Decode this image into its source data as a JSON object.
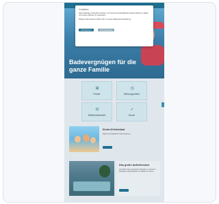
{
  "consent": {
    "title": "Cookies",
    "body1": "Diese Website verwendet Cookies, um Ihnen ein bestmögliches Nutzererlebnis zu bieten und unsere Dienste zu verbessern.",
    "body2": "Weitere Informationen finden Sie in unserer Datenschutzerklärung.",
    "accept_label": "Akzeptieren",
    "settings_label": "Einstellungen"
  },
  "hero": {
    "headline": "Badevergnügen für die ganze Familie"
  },
  "tiles": [
    {
      "label": "Preise",
      "icon": "ticket-icon",
      "glyph": "⊞"
    },
    {
      "label": "Öffnungszeiten",
      "icon": "clock-icon",
      "glyph": "◷"
    },
    {
      "label": "Wellnessbereich",
      "icon": "spa-icon",
      "glyph": "⊡"
    },
    {
      "label": "Kurse",
      "icon": "checklist-icon",
      "glyph": "✓"
    }
  ],
  "card_kids": {
    "title": "Kinder-Erlebnisbad",
    "subtitle": "Spiel und Spaß für die Kleinen"
  },
  "card_pool": {
    "title": "Das große Außenbecken",
    "text": "Genießen Sie entspannte Stunden in unserem beheizten Außenbecken mit Blick ins Grüne."
  },
  "colors": {
    "accent": "#1f6f8f",
    "tile": "#cfe3ea",
    "hero": "#3c7ea8"
  }
}
